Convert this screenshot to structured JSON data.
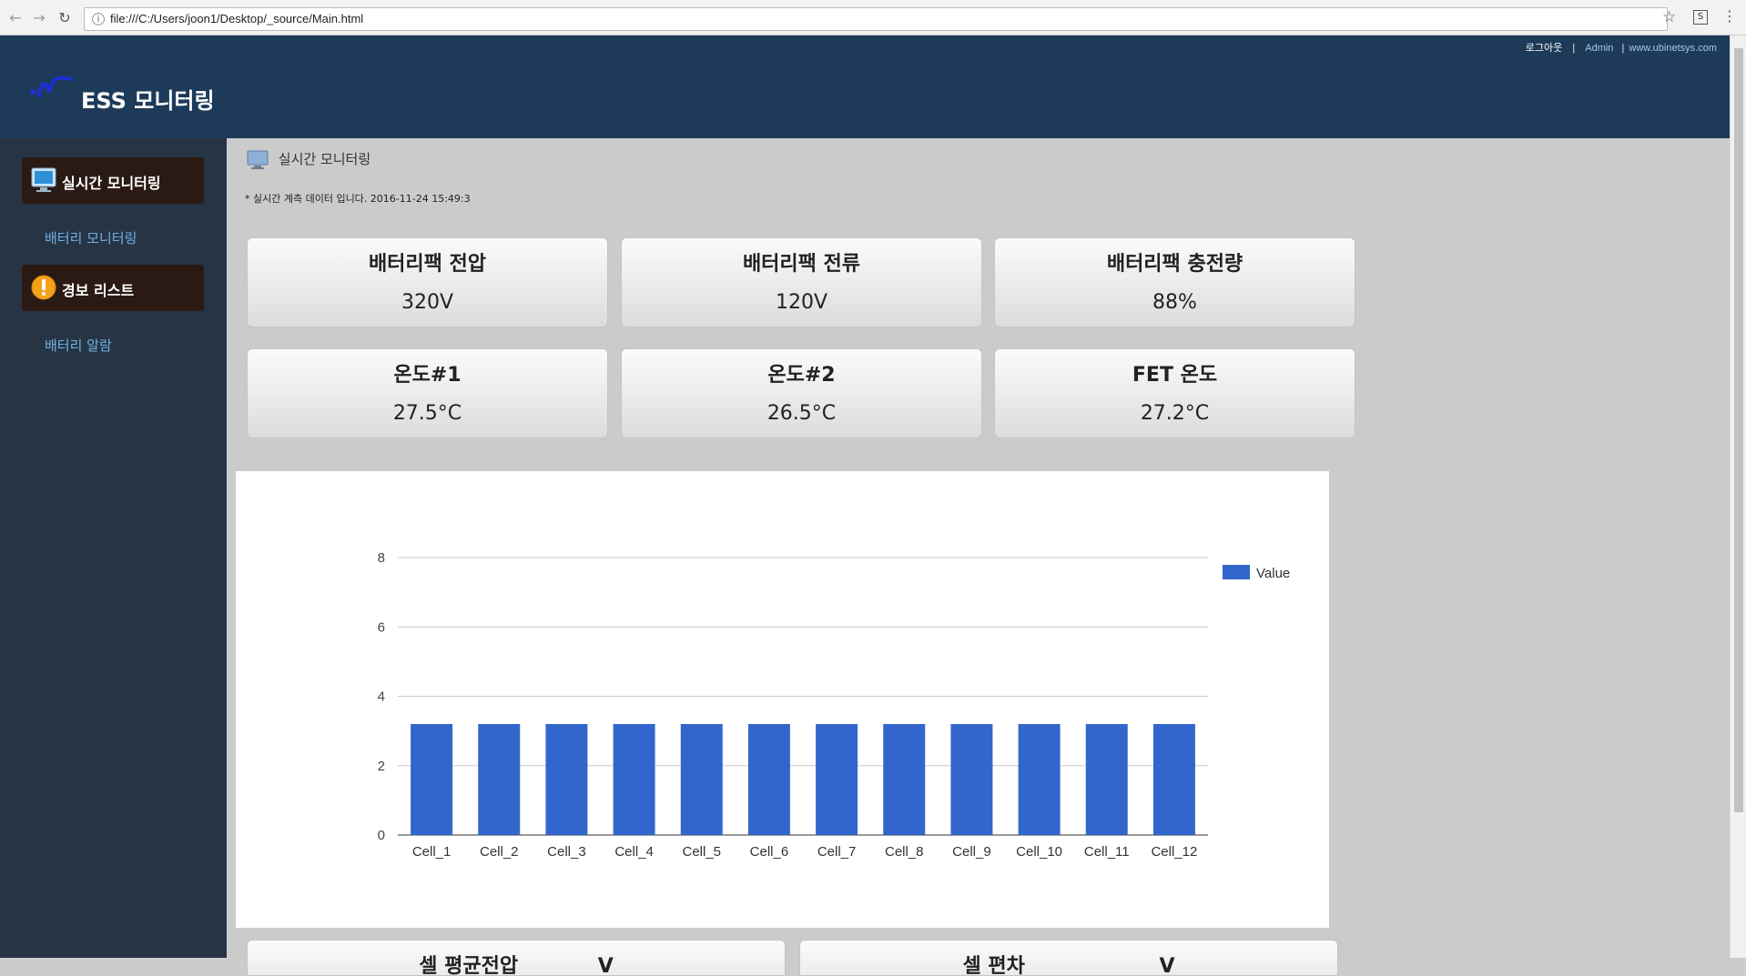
{
  "browser": {
    "url": "file:///C:/Users/joon1/Desktop/_source/Main.html"
  },
  "header": {
    "brand": "ESS 모니터링",
    "links": {
      "logout": "로그아웃",
      "sep1": "|",
      "admin": "Admin",
      "sep2": "|",
      "site": "www.ubinetsys.com"
    }
  },
  "sidebar": {
    "menus": [
      {
        "label": "실시간 모니터링",
        "icon": "monitor-icon",
        "sub": "배터리 모니터링"
      },
      {
        "label": "경보 리스트",
        "icon": "warning-icon",
        "sub": "배터리 알람"
      }
    ]
  },
  "main": {
    "title": "실시간 모니터링",
    "timestamp": "* 실시간 계측 데이터 입니다.  2016-11-24 15:49:3",
    "cards": [
      {
        "title": "배터리팩 전압",
        "value": "320V"
      },
      {
        "title": "배터리팩 전류",
        "value": "120V"
      },
      {
        "title": "배터리팩 충전량",
        "value": "88%"
      },
      {
        "title": "온도#1",
        "value": "27.5°C"
      },
      {
        "title": "온도#2",
        "value": "26.5°C"
      },
      {
        "title": "FET 온도",
        "value": "27.2°C"
      }
    ],
    "bottom_cards": [
      {
        "title": "셀 평균전압",
        "unit": "V"
      },
      {
        "title": "셀 편차",
        "unit": "V"
      }
    ]
  },
  "chart_data": {
    "type": "bar",
    "categories": [
      "Cell_1",
      "Cell_2",
      "Cell_3",
      "Cell_4",
      "Cell_5",
      "Cell_6",
      "Cell_7",
      "Cell_8",
      "Cell_9",
      "Cell_10",
      "Cell_11",
      "Cell_12"
    ],
    "series": [
      {
        "name": "Value",
        "values": [
          3.2,
          3.2,
          3.2,
          3.2,
          3.2,
          3.2,
          3.2,
          3.2,
          3.2,
          3.2,
          3.2,
          3.2
        ]
      }
    ],
    "yticks": [
      0,
      2,
      4,
      6,
      8
    ],
    "ylim": [
      0,
      8
    ],
    "grid": true,
    "legend": "right",
    "color": "#3366cc"
  }
}
